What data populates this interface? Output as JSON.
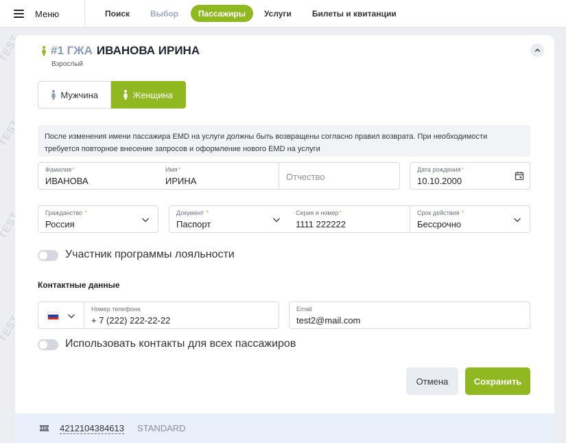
{
  "topbar": {
    "menu_label": "Меню",
    "tabs": [
      {
        "label": "Поиск",
        "state": "normal"
      },
      {
        "label": "Выбор",
        "state": "disabled"
      },
      {
        "label": "Пассажиры",
        "state": "active"
      },
      {
        "label": "Услуги",
        "state": "normal"
      },
      {
        "label": "Билеты и квитанции",
        "state": "normal"
      }
    ]
  },
  "watermark": "TEST",
  "passenger": {
    "number": "#1 ГЖА",
    "name": "ИВАНОВА ИРИНА",
    "type": "Взрослый",
    "gender_male": "Мужчина",
    "gender_female": "Женщина",
    "gender_selected": "female",
    "notice": "После изменения имени пассажира EMD на услуги должны быть возвращены согласно правил возврата. При необходимости требуется повторное внесение запросов и оформление нового EMD на услуги"
  },
  "fields": {
    "surname": {
      "label": "Фамилия",
      "value": "ИВАНОВА"
    },
    "name": {
      "label": "Имя",
      "value": "ИРИНА"
    },
    "patronymic": {
      "placeholder": "Отчество"
    },
    "birthdate": {
      "label": "Дата рождения",
      "value": "10.10.2000"
    },
    "citizenship": {
      "label": "Гражданство",
      "value": "Россия"
    },
    "document": {
      "label": "Документ",
      "value": "Паспорт"
    },
    "series_number": {
      "label": "Серия и номер",
      "value": "1111 222222"
    },
    "validity": {
      "label": "Срок действия",
      "value": "Бессрочно"
    }
  },
  "loyalty": {
    "label": "Участник программы лояльности",
    "checked": false
  },
  "contacts": {
    "title": "Контактные данные",
    "phone_label": "Номер телефона",
    "phone_value": "+ 7 (222) 222-22-22",
    "email_label": "Email",
    "email_value": "test2@mail.com",
    "country_flag": "ru-flag-icon"
  },
  "use_for_all": {
    "label": "Использовать контакты для всех пассажиров",
    "checked": false
  },
  "buttons": {
    "cancel": "Отмена",
    "save": "Сохранить"
  },
  "ticket": {
    "number": "4212104384613",
    "class": "STANDARD"
  },
  "colors": {
    "accent": "#90b820",
    "required": "#f2a93b",
    "muted": "#8a9bb6"
  }
}
